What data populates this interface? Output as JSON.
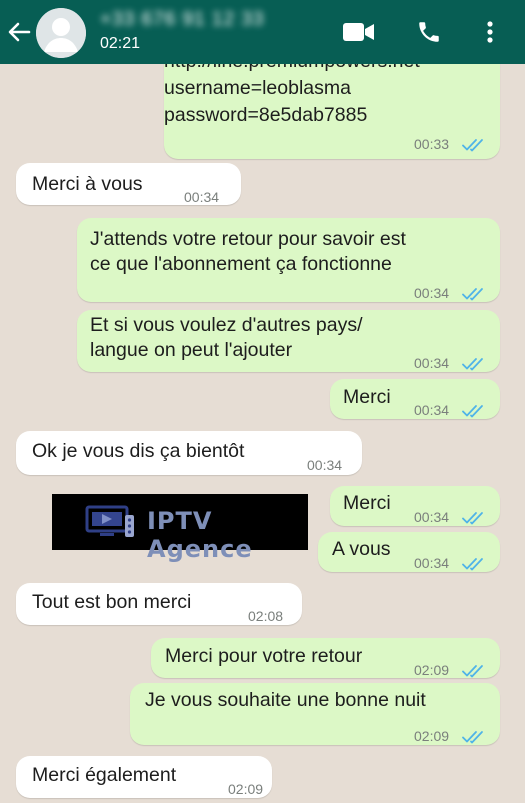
{
  "header": {
    "contact_name": "+33 676 91 12 33",
    "last_seen": "02:21"
  },
  "messages": [
    {
      "dir": "out",
      "lines": [
        "http://line.premiumpowers.net",
        "username=leoblasma",
        "password=8e5dab7885"
      ],
      "time": "00:33",
      "read": true
    },
    {
      "dir": "in",
      "lines": [
        "Merci à vous"
      ],
      "time": "00:34"
    },
    {
      "dir": "out",
      "lines": [
        "J'attends votre retour pour savoir est",
        "ce que l'abonnement ça fonctionne"
      ],
      "time": "00:34",
      "read": true
    },
    {
      "dir": "out",
      "lines": [
        "Et si vous voulez d'autres pays/",
        "langue on peut l'ajouter"
      ],
      "time": "00:34",
      "read": true
    },
    {
      "dir": "out",
      "lines": [
        "Merci"
      ],
      "time": "00:34",
      "read": true
    },
    {
      "dir": "in",
      "lines": [
        "Ok je vous dis ça bientôt"
      ],
      "time": "00:34"
    },
    {
      "dir": "out",
      "lines": [
        "Merci"
      ],
      "time": "00:34",
      "read": true
    },
    {
      "dir": "out",
      "lines": [
        "A vous"
      ],
      "time": "00:34",
      "read": true
    },
    {
      "dir": "in",
      "lines": [
        "Tout est bon merci"
      ],
      "time": "02:08"
    },
    {
      "dir": "out",
      "lines": [
        "Merci pour votre retour"
      ],
      "time": "02:09",
      "read": true
    },
    {
      "dir": "out",
      "lines": [
        "Je vous souhaite une bonne nuit"
      ],
      "time": "02:09",
      "read": true
    },
    {
      "dir": "in",
      "lines": [
        "Merci également"
      ],
      "time": "02:09"
    }
  ],
  "watermark": {
    "text": "IPTV Agence",
    "colors": {
      "background": "#000000",
      "text": "#7e8fb8",
      "icon": "#2f3f86"
    }
  },
  "colors": {
    "header": "#075e54",
    "chat_background": "#e6ddd4",
    "outgoing_bubble": "#dcf8c6",
    "incoming_bubble": "#ffffff",
    "read_ticks": "#4fb3e8"
  },
  "icons": {
    "back": "arrow-left-icon",
    "video": "video-camera-icon",
    "call": "phone-icon",
    "menu": "more-vertical-icon",
    "read": "double-check-icon"
  }
}
